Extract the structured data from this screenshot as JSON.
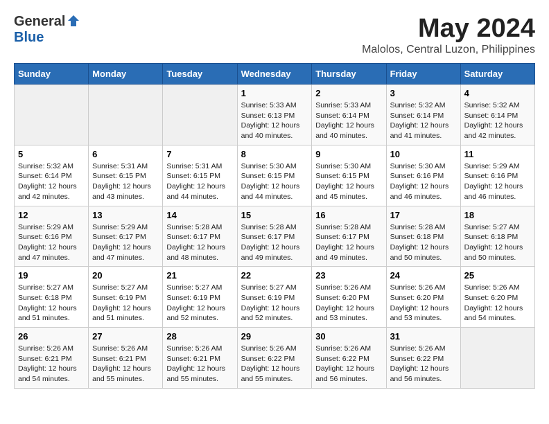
{
  "logo": {
    "general": "General",
    "blue": "Blue"
  },
  "title": "May 2024",
  "location": "Malolos, Central Luzon, Philippines",
  "days_of_week": [
    "Sunday",
    "Monday",
    "Tuesday",
    "Wednesday",
    "Thursday",
    "Friday",
    "Saturday"
  ],
  "weeks": [
    [
      {
        "day": "",
        "info": ""
      },
      {
        "day": "",
        "info": ""
      },
      {
        "day": "",
        "info": ""
      },
      {
        "day": "1",
        "info": "Sunrise: 5:33 AM\nSunset: 6:13 PM\nDaylight: 12 hours\nand 40 minutes."
      },
      {
        "day": "2",
        "info": "Sunrise: 5:33 AM\nSunset: 6:14 PM\nDaylight: 12 hours\nand 40 minutes."
      },
      {
        "day": "3",
        "info": "Sunrise: 5:32 AM\nSunset: 6:14 PM\nDaylight: 12 hours\nand 41 minutes."
      },
      {
        "day": "4",
        "info": "Sunrise: 5:32 AM\nSunset: 6:14 PM\nDaylight: 12 hours\nand 42 minutes."
      }
    ],
    [
      {
        "day": "5",
        "info": "Sunrise: 5:32 AM\nSunset: 6:14 PM\nDaylight: 12 hours\nand 42 minutes."
      },
      {
        "day": "6",
        "info": "Sunrise: 5:31 AM\nSunset: 6:15 PM\nDaylight: 12 hours\nand 43 minutes."
      },
      {
        "day": "7",
        "info": "Sunrise: 5:31 AM\nSunset: 6:15 PM\nDaylight: 12 hours\nand 44 minutes."
      },
      {
        "day": "8",
        "info": "Sunrise: 5:30 AM\nSunset: 6:15 PM\nDaylight: 12 hours\nand 44 minutes."
      },
      {
        "day": "9",
        "info": "Sunrise: 5:30 AM\nSunset: 6:15 PM\nDaylight: 12 hours\nand 45 minutes."
      },
      {
        "day": "10",
        "info": "Sunrise: 5:30 AM\nSunset: 6:16 PM\nDaylight: 12 hours\nand 46 minutes."
      },
      {
        "day": "11",
        "info": "Sunrise: 5:29 AM\nSunset: 6:16 PM\nDaylight: 12 hours\nand 46 minutes."
      }
    ],
    [
      {
        "day": "12",
        "info": "Sunrise: 5:29 AM\nSunset: 6:16 PM\nDaylight: 12 hours\nand 47 minutes."
      },
      {
        "day": "13",
        "info": "Sunrise: 5:29 AM\nSunset: 6:17 PM\nDaylight: 12 hours\nand 47 minutes."
      },
      {
        "day": "14",
        "info": "Sunrise: 5:28 AM\nSunset: 6:17 PM\nDaylight: 12 hours\nand 48 minutes."
      },
      {
        "day": "15",
        "info": "Sunrise: 5:28 AM\nSunset: 6:17 PM\nDaylight: 12 hours\nand 49 minutes."
      },
      {
        "day": "16",
        "info": "Sunrise: 5:28 AM\nSunset: 6:17 PM\nDaylight: 12 hours\nand 49 minutes."
      },
      {
        "day": "17",
        "info": "Sunrise: 5:28 AM\nSunset: 6:18 PM\nDaylight: 12 hours\nand 50 minutes."
      },
      {
        "day": "18",
        "info": "Sunrise: 5:27 AM\nSunset: 6:18 PM\nDaylight: 12 hours\nand 50 minutes."
      }
    ],
    [
      {
        "day": "19",
        "info": "Sunrise: 5:27 AM\nSunset: 6:18 PM\nDaylight: 12 hours\nand 51 minutes."
      },
      {
        "day": "20",
        "info": "Sunrise: 5:27 AM\nSunset: 6:19 PM\nDaylight: 12 hours\nand 51 minutes."
      },
      {
        "day": "21",
        "info": "Sunrise: 5:27 AM\nSunset: 6:19 PM\nDaylight: 12 hours\nand 52 minutes."
      },
      {
        "day": "22",
        "info": "Sunrise: 5:27 AM\nSunset: 6:19 PM\nDaylight: 12 hours\nand 52 minutes."
      },
      {
        "day": "23",
        "info": "Sunrise: 5:26 AM\nSunset: 6:20 PM\nDaylight: 12 hours\nand 53 minutes."
      },
      {
        "day": "24",
        "info": "Sunrise: 5:26 AM\nSunset: 6:20 PM\nDaylight: 12 hours\nand 53 minutes."
      },
      {
        "day": "25",
        "info": "Sunrise: 5:26 AM\nSunset: 6:20 PM\nDaylight: 12 hours\nand 54 minutes."
      }
    ],
    [
      {
        "day": "26",
        "info": "Sunrise: 5:26 AM\nSunset: 6:21 PM\nDaylight: 12 hours\nand 54 minutes."
      },
      {
        "day": "27",
        "info": "Sunrise: 5:26 AM\nSunset: 6:21 PM\nDaylight: 12 hours\nand 55 minutes."
      },
      {
        "day": "28",
        "info": "Sunrise: 5:26 AM\nSunset: 6:21 PM\nDaylight: 12 hours\nand 55 minutes."
      },
      {
        "day": "29",
        "info": "Sunrise: 5:26 AM\nSunset: 6:22 PM\nDaylight: 12 hours\nand 55 minutes."
      },
      {
        "day": "30",
        "info": "Sunrise: 5:26 AM\nSunset: 6:22 PM\nDaylight: 12 hours\nand 56 minutes."
      },
      {
        "day": "31",
        "info": "Sunrise: 5:26 AM\nSunset: 6:22 PM\nDaylight: 12 hours\nand 56 minutes."
      },
      {
        "day": "",
        "info": ""
      }
    ]
  ]
}
